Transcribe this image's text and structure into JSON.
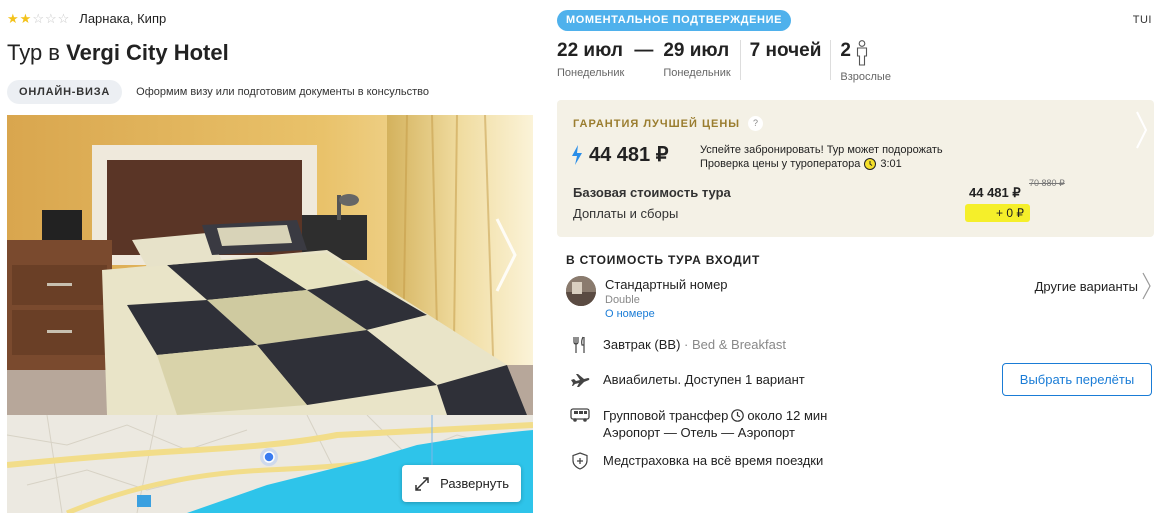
{
  "hotel": {
    "stars": 2,
    "stars_max": 5,
    "location": "Ларнака, Кипр",
    "title_prefix": "Тур в",
    "name": "Vergi City Hotel",
    "visa_badge": "ОНЛАЙН-ВИЗА",
    "visa_note": "Оформим визу или подготовим документы в консульство",
    "expand_label": "Развернуть"
  },
  "tour": {
    "instant_badge": "МОМЕНТАЛЬНОЕ ПОДТВЕРЖДЕНИЕ",
    "operator": "TUI",
    "date_from": "22 июл",
    "date_from_day": "Понедельник",
    "dash": "—",
    "date_to": "29 июл",
    "date_to_day": "Понедельник",
    "nights": "7 ночей",
    "adults_count": "2",
    "adults_label": "Взрослые"
  },
  "price": {
    "guarantee": "ГАРАНТИЯ ЛУЧШЕЙ ЦЕНЫ",
    "question_mark": "?",
    "total": "44 481 ₽",
    "hurry_line1": "Успейте забронировать! Тур может подорожать",
    "hurry_line2": "Проверка цены у туроператора",
    "timer": "3:01",
    "base_label": "Базовая стоимость тура",
    "base_value": "44 481 ₽",
    "old_price": "70 880 ₽",
    "fees_label": "Доплаты и сборы",
    "fees_value": "+ 0 ₽"
  },
  "includes": {
    "title": "В СТОИМОСТЬ ТУРА ВХОДИТ",
    "room_name": "Стандартный номер",
    "room_type": "Double",
    "room_link": "О номере",
    "other_variants": "Другие варианты",
    "meal": "Завтрак (BB)",
    "meal_sep": "·",
    "meal_detail": "Bed & Breakfast",
    "flights": "Авиабилеты. Доступен 1 вариант",
    "flights_button": "Выбрать перелёты",
    "transfer_line1a": "Групповой трансфер",
    "transfer_time": "около 12 мин",
    "transfer_line2": "Аэропорт — Отель — Аэропорт",
    "insurance": "Медстраховка на всё время поездки"
  },
  "colors": {
    "accent_blue": "#1a7cd6",
    "badge_blue": "#4fb1ec",
    "price_card_bg": "#f4f1e6",
    "highlight_yellow": "#f5ef2a",
    "star_yellow": "#f3c21a"
  }
}
